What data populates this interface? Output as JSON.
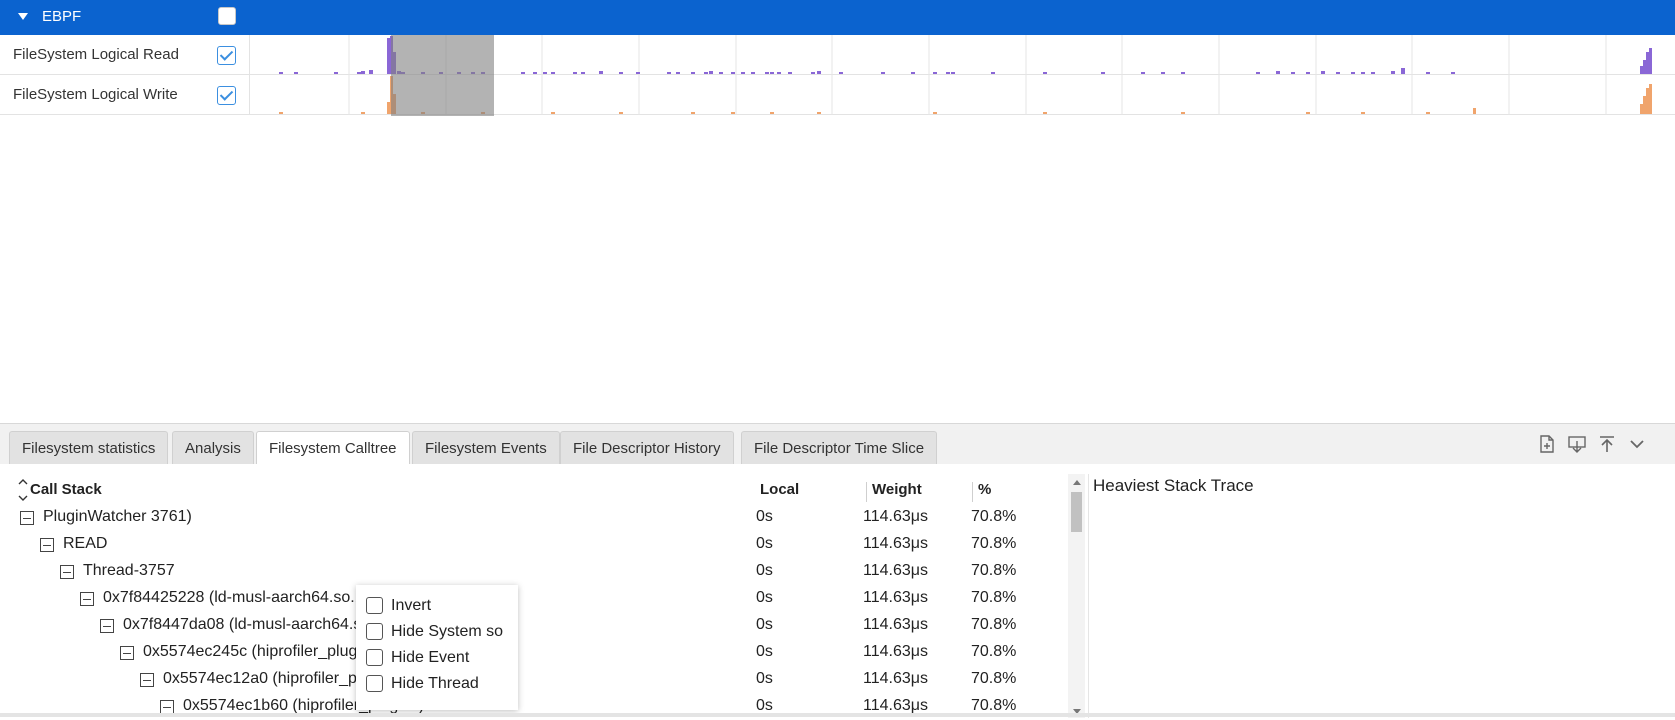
{
  "group": {
    "title": "EBPF",
    "checked": false
  },
  "tracks": [
    {
      "name": "FileSystem Logical Read",
      "checked": true,
      "color": "#8a67d6"
    },
    {
      "name": "FileSystem Logical Write",
      "checked": true,
      "color": "#f0a46c"
    }
  ],
  "tabs": [
    {
      "label": "Filesystem statistics",
      "active": false
    },
    {
      "label": "Analysis",
      "active": false
    },
    {
      "label": "Filesystem Calltree",
      "active": true
    },
    {
      "label": "Filesystem Events",
      "active": false
    },
    {
      "label": "File Descriptor History",
      "active": false
    },
    {
      "label": "File Descriptor Time Slice",
      "active": false
    }
  ],
  "tools": [
    "export-file-icon",
    "download-icon",
    "collapse-up-icon",
    "chevron-down-icon"
  ],
  "columns": {
    "call_stack": "Call Stack",
    "local": "Local",
    "weight": "Weight",
    "percent": "%"
  },
  "rows": [
    {
      "name": "PluginWatcher 3761)",
      "local": "0s",
      "weight": "114.63μs",
      "percent": "70.8%"
    },
    {
      "name": "READ",
      "local": "0s",
      "weight": "114.63μs",
      "percent": "70.8%"
    },
    {
      "name": "Thread-3757",
      "local": "0s",
      "weight": "114.63μs",
      "percent": "70.8%"
    },
    {
      "name": "0x7f84425228 (ld-musl-aarch64.so.1)",
      "local": "0s",
      "weight": "114.63μs",
      "percent": "70.8%"
    },
    {
      "name": "0x7f8447da08 (ld-musl-aarch64.so.1)",
      "local": "0s",
      "weight": "114.63μs",
      "percent": "70.8%"
    },
    {
      "name": "0x5574ec245c (hiprofiler_plugins)",
      "local": "0s",
      "weight": "114.63μs",
      "percent": "70.8%"
    },
    {
      "name": "0x5574ec12a0 (hiprofiler_plugins)",
      "local": "0s",
      "weight": "114.63μs",
      "percent": "70.8%"
    },
    {
      "name": "0x5574ec1b60 (hiprofiler_plugins)",
      "local": "0s",
      "weight": "114.63μs",
      "percent": "70.8%"
    }
  ],
  "heaviest_title": "Heaviest Stack Trace",
  "menu": [
    {
      "label": "Invert",
      "checked": false
    },
    {
      "label": "Hide System so",
      "checked": false
    },
    {
      "label": "Hide Event",
      "checked": false
    },
    {
      "label": "Hide Thread",
      "checked": false
    }
  ]
}
